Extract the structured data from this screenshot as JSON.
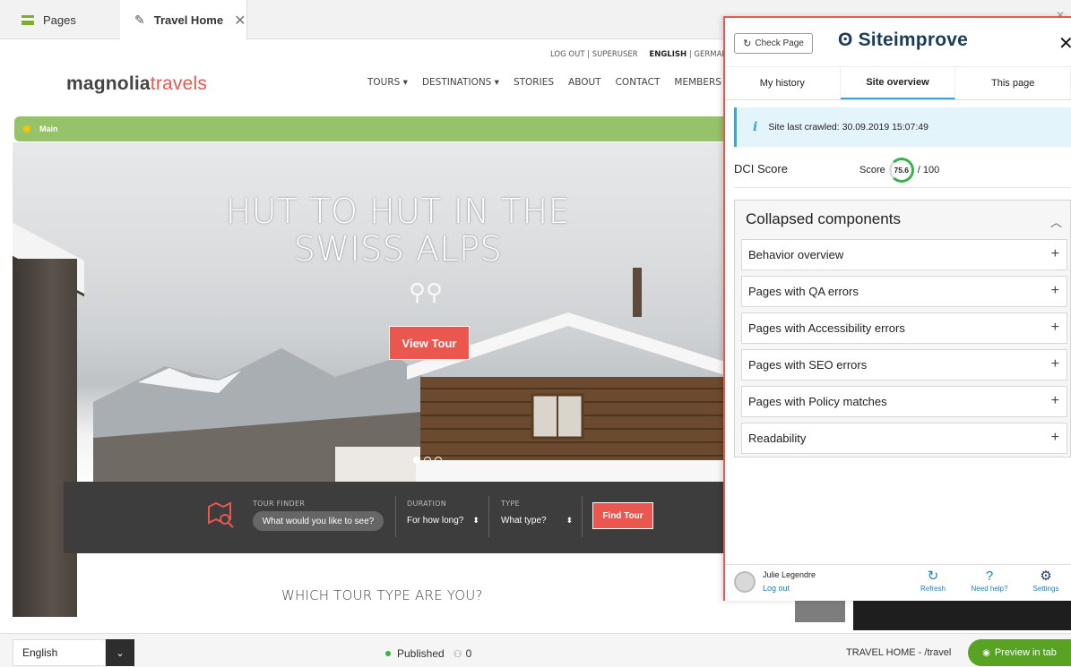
{
  "tabs": {
    "pages_label": "Pages",
    "travel_label": "Travel Home",
    "close_glyph": "✕"
  },
  "site": {
    "logout_link": "LOG OUT | SUPERUSER",
    "lang_english": "ENGLISH",
    "lang_sep": " | ",
    "lang_german": "GERMAN",
    "logo_main": "magnolia",
    "logo_accent": "travels",
    "nav": [
      "TOURS ▾",
      "DESTINATIONS ▾",
      "STORIES",
      "ABOUT",
      "CONTACT",
      "MEMBERS"
    ],
    "main_label": "Main",
    "hero_title": "HUT TO HUT IN THE SWISS ALPS",
    "view_tour": "View Tour",
    "finder": {
      "tour_finder_label": "TOUR FINDER",
      "tour_placeholder": "What would you like to see?",
      "duration_label": "DURATION",
      "duration_value": "For how long?",
      "type_label": "TYPE",
      "type_value": "What type?",
      "find_button": "Find Tour"
    },
    "which_tour": "WHICH TOUR TYPE ARE YOU?"
  },
  "siteimprove": {
    "check_page": "Check Page",
    "logo": "Siteimprove",
    "tabs": [
      "My history",
      "Site overview",
      "This page"
    ],
    "active_tab": 1,
    "crawl_info": "Site last crawled: 30.09.2019 15:07:49",
    "dci_label": "DCI Score",
    "score_prefix": "Score",
    "score_value": "75.6",
    "score_suffix": "/ 100",
    "collapsed_title": "Collapsed components",
    "items": [
      "Behavior overview",
      "Pages with QA errors",
      "Pages with Accessibility errors",
      "Pages with SEO errors",
      "Pages with Policy matches",
      "Readability"
    ],
    "user_name": "Julie Legendre",
    "logout": "Log out",
    "refresh": "Refresh",
    "help": "Need help?",
    "settings": "Settings",
    "colors": {
      "accent": "#3aa6d6",
      "score": "#38b24a",
      "border": "#e9574e"
    }
  },
  "bottombar": {
    "language": "English",
    "status": "Published",
    "users_count": "0",
    "breadcrumb": "TRAVEL HOME - /travel",
    "preview": "Preview in tab"
  }
}
